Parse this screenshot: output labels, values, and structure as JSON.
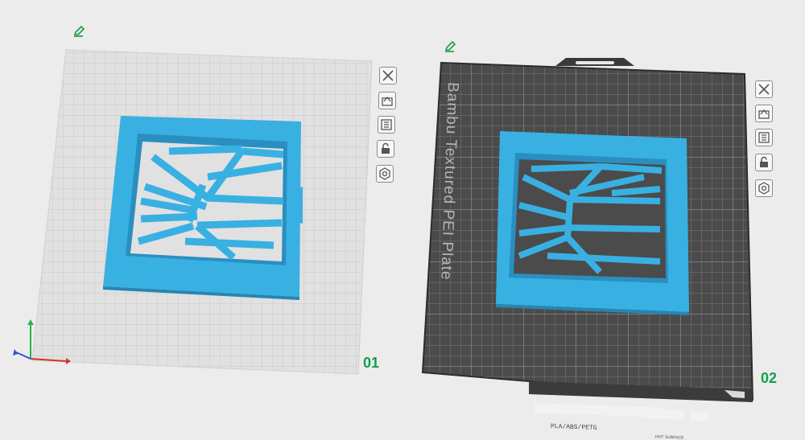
{
  "plates": [
    {
      "index_label": "01",
      "surface": "cool plate (light grey grid)",
      "edit_icon": "pencil-icon",
      "buttons": [
        {
          "name": "remove-plate-button",
          "icon": "close-icon"
        },
        {
          "name": "arrange-button",
          "icon": "arrange-icon"
        },
        {
          "name": "plate-settings-button",
          "icon": "plate-settings-icon"
        },
        {
          "name": "lock-plate-button",
          "icon": "lock-icon"
        },
        {
          "name": "plate-gear-button",
          "icon": "hex-gear-icon"
        }
      ]
    },
    {
      "index_label": "02",
      "bed_text": "Bambu Textured PEI Plate",
      "label_strip": "PLA/ABS/PETG",
      "hot_warning": "HOT SURFACE",
      "edit_icon": "pencil-icon",
      "buttons": [
        {
          "name": "remove-plate-button",
          "icon": "close-icon"
        },
        {
          "name": "arrange-button",
          "icon": "arrange-icon"
        },
        {
          "name": "plate-settings-button",
          "icon": "plate-settings-icon"
        },
        {
          "name": "lock-plate-button",
          "icon": "lock-icon"
        },
        {
          "name": "plate-gear-button",
          "icon": "hex-gear-icon"
        }
      ]
    }
  ],
  "colors": {
    "background": "#ececec",
    "cool_plate": "#e2e2e2",
    "pei_plate": "#4a4a4a",
    "model": "#39b0e2",
    "model_shadow": "#2586b4",
    "plate_number": "#11a04a",
    "axis_x": "#d2342a",
    "axis_y": "#2fb24a",
    "axis_z": "#2a56d2"
  }
}
